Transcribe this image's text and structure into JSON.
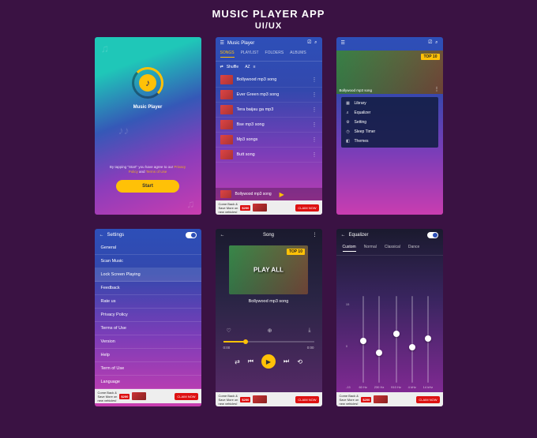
{
  "page": {
    "title": "MUSIC PLAYER APP",
    "subtitle": "UI/UX"
  },
  "splash": {
    "app_name": "Music Player",
    "legal_pre": "By tapping \"Start\" you have agree to our",
    "privacy": "Privacy Policy",
    "and": "and",
    "terms": "Terms of Use",
    "start": "Start"
  },
  "list": {
    "header_title": "Music Player",
    "tabs": [
      "SONGS",
      "PLAYLIST",
      "FOLDERS",
      "ALBUMS"
    ],
    "shuffle": "Shuffle",
    "sort": "AZ",
    "songs": [
      "Bollywood mp3 song",
      "Ever Green mp3 song",
      "Tera baijau ga mp3",
      "Bse mp3 song",
      "Mp3 songs",
      "Butt song"
    ],
    "now_playing": "Bollywood mp3 song"
  },
  "menu": {
    "hero_tag": "TOP 10",
    "hero_sub": "Bollywood mp3 song",
    "items": [
      "Library",
      "Equalizer",
      "Setting",
      "Sleep Timer",
      "Themes"
    ]
  },
  "settings": {
    "title": "Settings",
    "rows": [
      "General",
      "Scan Music",
      "Lock Screen Playing",
      "Feedback",
      "Rate us",
      "Privacy Policy",
      "Terms of Use",
      "Version",
      "Help",
      "Term of Use",
      "Language"
    ]
  },
  "player": {
    "title": "Song",
    "hero_tag": "TOP 10",
    "playall": "PLAY ALL",
    "track": "Bollywood mp3 song",
    "t_cur": "0:00",
    "t_end": "0:00"
  },
  "eq": {
    "title": "Equalizer",
    "presets": [
      "Custom",
      "Normal",
      "Classical",
      "Dance"
    ],
    "scale": [
      "15",
      "0",
      "-15"
    ],
    "bands": [
      {
        "freq": "60 Hz",
        "pos": 48
      },
      {
        "freq": "230 Hz",
        "pos": 62
      },
      {
        "freq": "910 Hz",
        "pos": 40
      },
      {
        "freq": "4 kHz",
        "pos": 55
      },
      {
        "freq": "14 kHz",
        "pos": 45
      }
    ]
  },
  "ad": {
    "line1": "Come Back &",
    "line2": "Save More on",
    "line3": "new vehicles!",
    "badge": "$200",
    "cta": "CLAIM NOW"
  }
}
